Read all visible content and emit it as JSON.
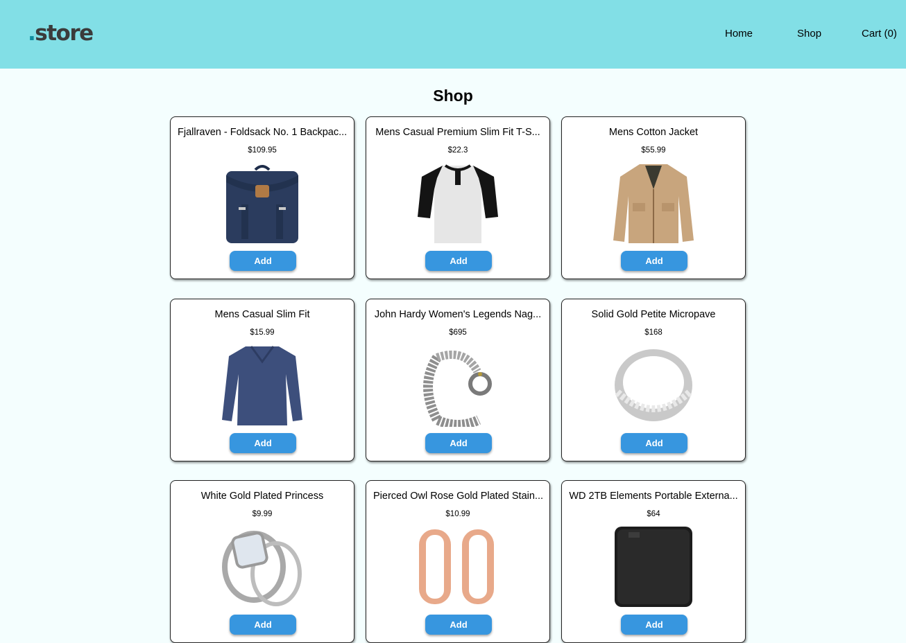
{
  "header": {
    "logo_dot": ".",
    "logo_text": "store",
    "nav": {
      "home": "Home",
      "shop": "Shop",
      "cart": "Cart (0)"
    }
  },
  "page": {
    "title": "Shop"
  },
  "products": [
    {
      "name": "Fjallraven - Foldsack No. 1 Backpac...",
      "price": "$109.95",
      "add_label": "Add",
      "icon": "backpack-image"
    },
    {
      "name": "Mens Casual Premium Slim Fit T-S...",
      "price": "$22.3",
      "add_label": "Add",
      "icon": "henley-tshirt-image"
    },
    {
      "name": "Mens Cotton Jacket",
      "price": "$55.99",
      "add_label": "Add",
      "icon": "jacket-image"
    },
    {
      "name": "Mens Casual Slim Fit",
      "price": "$15.99",
      "add_label": "Add",
      "icon": "long-sleeve-shirt-image"
    },
    {
      "name": "John Hardy Women's Legends Nag...",
      "price": "$695",
      "add_label": "Add",
      "icon": "chain-bracelet-image"
    },
    {
      "name": "Solid Gold Petite Micropave",
      "price": "$168",
      "add_label": "Add",
      "icon": "silver-ring-image"
    },
    {
      "name": "White Gold Plated Princess",
      "price": "$9.99",
      "add_label": "Add",
      "icon": "diamond-ring-set-image"
    },
    {
      "name": "Pierced Owl Rose Gold Plated Stain...",
      "price": "$10.99",
      "add_label": "Add",
      "icon": "rose-gold-plugs-image"
    },
    {
      "name": "WD 2TB Elements Portable Externa...",
      "price": "$64",
      "add_label": "Add",
      "icon": "external-hard-drive-image"
    }
  ],
  "colors": {
    "header_bg": "#82dfe6",
    "page_bg": "#f4fefe",
    "button_bg": "#3796df",
    "logo_dot": "#0f8ea0",
    "logo_text": "#3b3b3b"
  }
}
